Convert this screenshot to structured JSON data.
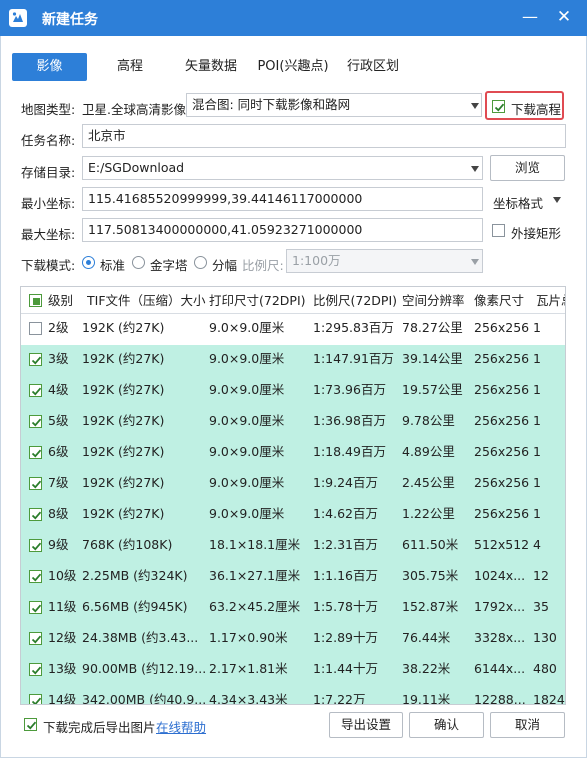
{
  "window": {
    "title": "新建任务",
    "min_label": "—",
    "close_label": "✕",
    "accent_color": "#2d7fd8"
  },
  "tabs": [
    {
      "label": "影像",
      "active": true
    },
    {
      "label": "高程",
      "active": false
    },
    {
      "label": "矢量数据",
      "active": false
    },
    {
      "label": "POI(兴趣点)",
      "active": false
    },
    {
      "label": "行政区划",
      "active": false
    }
  ],
  "form": {
    "map_type_label": "地图类型:",
    "map_type_value": "卫星.全球高清影像",
    "mix_value": "混合图: 同时下载影像和路网",
    "download_elevation_label": "下载高程",
    "download_elevation_checked": true,
    "task_name_label": "任务名称:",
    "task_name_value": "北京市",
    "storage_label": "存储目录:",
    "storage_value": "E:/SGDownload",
    "browse_label": "浏览",
    "min_coord_label": "最小坐标:",
    "min_coord_value": "115.41685520999999,39.44146117000000",
    "coord_format_label": "坐标格式",
    "max_coord_label": "最大坐标:",
    "max_coord_value": "117.50813400000000,41.05923271000000",
    "outer_rect_label": "外接矩形",
    "outer_rect_checked": false,
    "download_mode_label": "下载模式:",
    "mode_options": [
      {
        "label": "标准",
        "selected": true
      },
      {
        "label": "金字塔",
        "selected": false
      },
      {
        "label": "分幅",
        "selected": false
      }
    ],
    "scale_label": "比例尺:",
    "scale_value": "1:100万"
  },
  "table": {
    "columns": [
      "级别",
      "TIF文件（压缩）大小",
      "打印尺寸(72DPI)",
      "比例尺(72DPI)",
      "空间分辨率",
      "像素尺寸",
      "瓦片总"
    ],
    "header_checked": true,
    "rows": [
      {
        "checked": false,
        "level": "2级",
        "tif": "192K (约27K)",
        "print": "9.0×9.0厘米",
        "scale": "1:295.83百万",
        "res": "78.27公里",
        "pixel": "256x256",
        "tiles": "1"
      },
      {
        "checked": true,
        "level": "3级",
        "tif": "192K (约27K)",
        "print": "9.0×9.0厘米",
        "scale": "1:147.91百万",
        "res": "39.14公里",
        "pixel": "256x256",
        "tiles": "1"
      },
      {
        "checked": true,
        "level": "4级",
        "tif": "192K (约27K)",
        "print": "9.0×9.0厘米",
        "scale": "1:73.96百万",
        "res": "19.57公里",
        "pixel": "256x256",
        "tiles": "1"
      },
      {
        "checked": true,
        "level": "5级",
        "tif": "192K (约27K)",
        "print": "9.0×9.0厘米",
        "scale": "1:36.98百万",
        "res": "9.78公里",
        "pixel": "256x256",
        "tiles": "1"
      },
      {
        "checked": true,
        "level": "6级",
        "tif": "192K (约27K)",
        "print": "9.0×9.0厘米",
        "scale": "1:18.49百万",
        "res": "4.89公里",
        "pixel": "256x256",
        "tiles": "1"
      },
      {
        "checked": true,
        "level": "7级",
        "tif": "192K (约27K)",
        "print": "9.0×9.0厘米",
        "scale": "1:9.24百万",
        "res": "2.45公里",
        "pixel": "256x256",
        "tiles": "1"
      },
      {
        "checked": true,
        "level": "8级",
        "tif": "192K (约27K)",
        "print": "9.0×9.0厘米",
        "scale": "1:4.62百万",
        "res": "1.22公里",
        "pixel": "256x256",
        "tiles": "1"
      },
      {
        "checked": true,
        "level": "9级",
        "tif": "768K (约108K)",
        "print": "18.1×18.1厘米",
        "scale": "1:2.31百万",
        "res": "611.50米",
        "pixel": "512x512",
        "tiles": "4"
      },
      {
        "checked": true,
        "level": "10级",
        "tif": "2.25MB (约324K)",
        "print": "36.1×27.1厘米",
        "scale": "1:1.16百万",
        "res": "305.75米",
        "pixel": "1024x...",
        "tiles": "12"
      },
      {
        "checked": true,
        "level": "11级",
        "tif": "6.56MB (约945K)",
        "print": "63.2×45.2厘米",
        "scale": "1:5.78十万",
        "res": "152.87米",
        "pixel": "1792x...",
        "tiles": "35"
      },
      {
        "checked": true,
        "level": "12级",
        "tif": "24.38MB (约3.43...",
        "print": "1.17×0.90米",
        "scale": "1:2.89十万",
        "res": "76.44米",
        "pixel": "3328x...",
        "tiles": "130"
      },
      {
        "checked": true,
        "level": "13级",
        "tif": "90.00MB (约12.19...",
        "print": "2.17×1.81米",
        "scale": "1:1.44十万",
        "res": "38.22米",
        "pixel": "6144x...",
        "tiles": "480"
      },
      {
        "checked": true,
        "level": "14级",
        "tif": "342.00MB (约40.9...",
        "print": "4.34×3.43米",
        "scale": "1:7.22万",
        "res": "19.11米",
        "pixel": "12288...",
        "tiles": "1824"
      }
    ]
  },
  "footer": {
    "export_checkbox_label": "下载完成后导出图片",
    "export_checkbox_checked": true,
    "help_link": "在线帮助",
    "export_settings_label": "导出设置",
    "ok_label": "确认",
    "cancel_label": "取消"
  }
}
